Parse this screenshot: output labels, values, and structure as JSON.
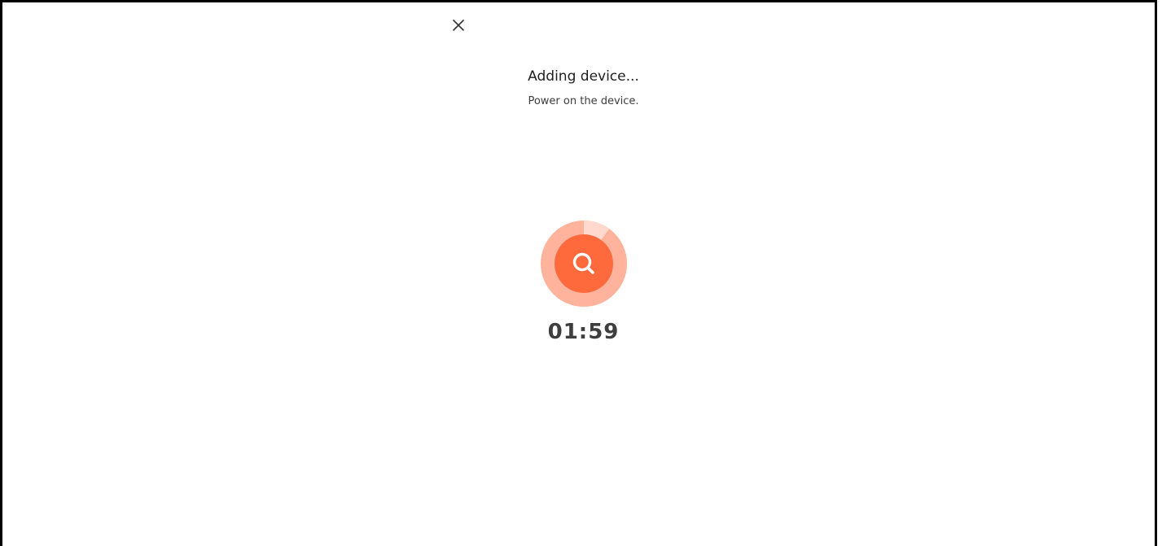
{
  "dialog": {
    "title": "Adding device...",
    "subtitle": "Power on the device.",
    "timer": "01:59",
    "close_icon": "close-icon",
    "search_icon": "search-icon"
  },
  "colors": {
    "accent": "#ff6a3d",
    "ring": "#ffb39c",
    "ring_light": "#ffd9cd"
  },
  "progress": {
    "scan_fraction_complete": 0.1
  }
}
